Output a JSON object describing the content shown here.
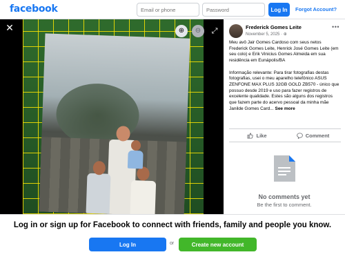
{
  "header": {
    "logo": "facebook",
    "email_placeholder": "Email or phone",
    "password_placeholder": "Password",
    "login_label": "Log In",
    "forgot_label": "Forgot Account?"
  },
  "post": {
    "author": "Frederick Gomes Leite",
    "date": "November 5, 2025",
    "privacy_icon": "globe-icon",
    "caption_p1": "Meu avô Jair Gomes Cardoso com seus netos Frederick Gomes Leite, Henrick José Gomes Leite (em seu colo) e Erik Vinicius Gomes Almeida em sua residência em Eunápolis/BA",
    "caption_p2": "Informação relevante: Para tirar fotografias destas fotografias, usei o meu aparelho telefônico ASUS ZENFONE MAX PLUS 32GB GOLD ZB570 - único que possuo desde 2019 e uso para fazer registros de excelente qualidade. Estes são alguns dos registros que fazem parte do acervo pessoal da minha mãe Janilde Gomes Card...",
    "see_more": "See more",
    "like_label": "Like",
    "comment_label": "Comment",
    "no_comments": "No comments yet",
    "be_first": "Be the first to comment."
  },
  "banner": {
    "title": "Log in or sign up for Facebook to connect with friends, family and people you know.",
    "login_label": "Log In",
    "or_label": "or",
    "create_label": "Create new account"
  },
  "colors": {
    "brand": "#1877f2",
    "create": "#42b72a"
  }
}
